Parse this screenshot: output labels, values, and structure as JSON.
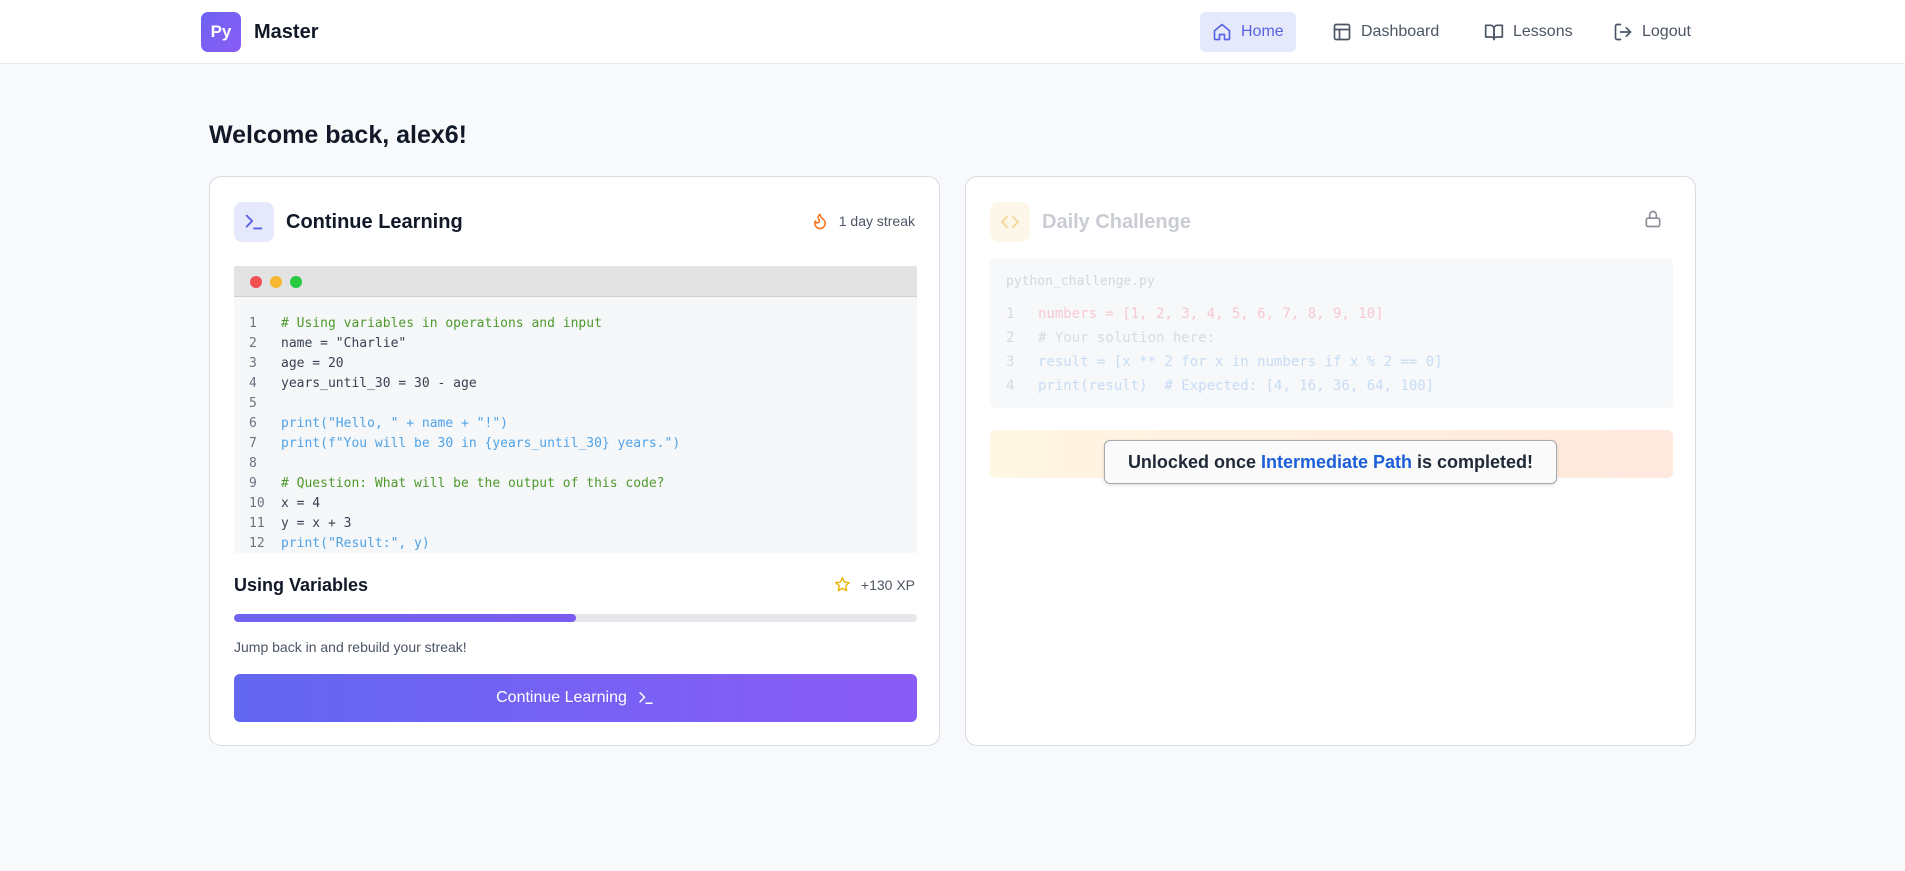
{
  "brand": {
    "badge": "Py",
    "name": "Master"
  },
  "nav": {
    "items": [
      {
        "label": "Home",
        "icon": "home-icon",
        "active": true
      },
      {
        "label": "Dashboard",
        "icon": "layout-icon",
        "active": false
      },
      {
        "label": "Lessons",
        "icon": "book-icon",
        "active": false
      },
      {
        "label": "Logout",
        "icon": "logout-icon",
        "active": false
      }
    ]
  },
  "welcome": "Welcome back, alex6!",
  "continue_card": {
    "title": "Continue Learning",
    "streak": "1 day streak",
    "code_lines": [
      {
        "n": "1",
        "text": "# Using variables in operations and input",
        "kind": "comment"
      },
      {
        "n": "2",
        "text": "name = \"Charlie\"",
        "kind": "plain"
      },
      {
        "n": "3",
        "text": "age = 20",
        "kind": "plain"
      },
      {
        "n": "4",
        "text": "years_until_30 = 30 - age",
        "kind": "plain"
      },
      {
        "n": "5",
        "text": "",
        "kind": "plain"
      },
      {
        "n": "6",
        "text": "print(\"Hello, \" + name + \"!\")",
        "kind": "call"
      },
      {
        "n": "7",
        "text": "print(f\"You will be 30 in {years_until_30} years.\")",
        "kind": "call"
      },
      {
        "n": "8",
        "text": "",
        "kind": "plain"
      },
      {
        "n": "9",
        "text": "# Question: What will be the output of this code?",
        "kind": "comment"
      },
      {
        "n": "10",
        "text": "x = 4",
        "kind": "plain"
      },
      {
        "n": "11",
        "text": "y = x + 3",
        "kind": "plain"
      },
      {
        "n": "12",
        "text": "print(\"Result:\", y)",
        "kind": "call"
      }
    ],
    "lesson_title": "Using Variables",
    "xp": "+130 XP",
    "progress_percent": 50,
    "subtext": "Jump back in and rebuild your streak!",
    "button_label": "Continue Learning"
  },
  "challenge_card": {
    "title": "Daily Challenge",
    "filename": "python_challenge.py",
    "code_lines": [
      {
        "n": "1",
        "text": "numbers = [1, 2, 3, 4, 5, 6, 7, 8, 9, 10]",
        "color": "#f6c9cf"
      },
      {
        "n": "2",
        "text": "# Your solution here:",
        "color": "#d8dbe0"
      },
      {
        "n": "3",
        "text": "result = [x ** 2 for x in numbers if x % 2 == 0]",
        "color": "#c7dcf5"
      },
      {
        "n": "4",
        "text": "print(result)  # Expected: [4, 16, 36, 64, 100]",
        "color": "#c7dcf5"
      }
    ],
    "lock_message": {
      "before": "Unlocked once ",
      "highlight": "Intermediate Path",
      "after": " is completed!"
    }
  },
  "colors": {
    "accent": "#6366f1",
    "accent_2": "#8b5cf6",
    "link": "#1d5fd8",
    "streak": "#f97316",
    "star": "#eab308"
  }
}
